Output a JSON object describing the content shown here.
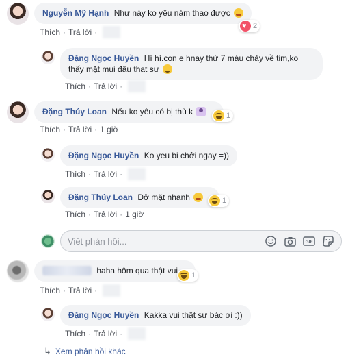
{
  "actions": {
    "like": "Thích",
    "reply": "Trả lời",
    "sep": "·"
  },
  "comments": [
    {
      "author": "Nguyễn Mỹ Hạnh",
      "text": "Như này ko yêu nàm thao được",
      "reactions": "2"
    },
    {
      "author": "Đặng Ngọc Huyền",
      "text_line1": "Hí hí.con e hnay thứ 7 máu chảy về tim,ko",
      "text_line2": "thấy mặt mui đâu that sự"
    },
    {
      "author": "Đặng Thúy Loan",
      "text": "Nếu ko yêu có bị thù k",
      "reactions": "1",
      "time": "1 giờ"
    },
    {
      "author": "Đặng Ngọc Huyền",
      "text": "Ko yeu bi chởi ngay =))"
    },
    {
      "author": "Đặng Thúy Loan",
      "text": "Dở mặt nhanh",
      "reactions": "1",
      "time": "1 giờ"
    },
    {
      "text": "haha hôm qua thật vui",
      "reactions": "1"
    },
    {
      "author": "Đặng Ngọc Huyền",
      "text": "Kakka vui thật sự bác ơi :))"
    }
  ],
  "reply_input": {
    "placeholder": "Viết phản hồi..."
  },
  "more_replies": "Xem phản hồi khác",
  "icons": [
    "emoji-icon",
    "camera-icon",
    "gif-icon",
    "sticker-icon",
    "reply-arrow-icon"
  ]
}
